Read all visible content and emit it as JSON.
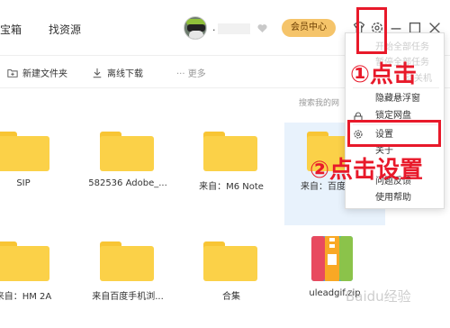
{
  "header": {
    "tabs": [
      "宝箱",
      "找资源"
    ],
    "username": ".",
    "vip_label": "会员中心"
  },
  "toolbar": {
    "new_folder": "新建文件夹",
    "offline_download": "离线下载",
    "more": "··· 更多"
  },
  "search": {
    "placeholder": "搜索我的网"
  },
  "files": [
    {
      "name": "SIP",
      "type": "folder"
    },
    {
      "name": "582536 Adobe_...",
      "type": "folder"
    },
    {
      "name": "来自：M6 Note",
      "type": "folder"
    },
    {
      "name": "来自：百度",
      "type": "folder"
    },
    {
      "name": "来自：HM 2A",
      "type": "folder"
    },
    {
      "name": "来自百度手机浏...",
      "type": "folder"
    },
    {
      "name": "合集",
      "type": "folder"
    },
    {
      "name": "uleadgif.zip",
      "type": "zip"
    }
  ],
  "menu": {
    "items": [
      {
        "label": "开始全部任务",
        "faded": true
      },
      {
        "label": "暂停全部任务",
        "faded": true
      },
      {
        "label": "动关机",
        "faded": true
      },
      {
        "label": "隐藏悬浮窗",
        "faded": false
      },
      {
        "label": "锁定网盘",
        "faded": false
      },
      {
        "label": "设置",
        "faded": false
      },
      {
        "label": "关于",
        "faded": false
      },
      {
        "label": "问题反馈",
        "faded": false
      },
      {
        "label": "使用帮助",
        "faded": false
      }
    ]
  },
  "annotations": {
    "step1": "①点击",
    "step2": "②点击设置"
  },
  "watermark": "Baidu经验",
  "colors": {
    "annotation_red": "#e8192a",
    "folder_yellow": "#fbd148",
    "vip_gold": "#f5c46a"
  },
  "icons": [
    "folder-plus-icon",
    "download-icon",
    "avatar",
    "heart-icon",
    "shirt-icon",
    "gear-icon",
    "minimize-icon",
    "maximize-icon",
    "close-icon",
    "lock-icon",
    "settings-icon"
  ]
}
